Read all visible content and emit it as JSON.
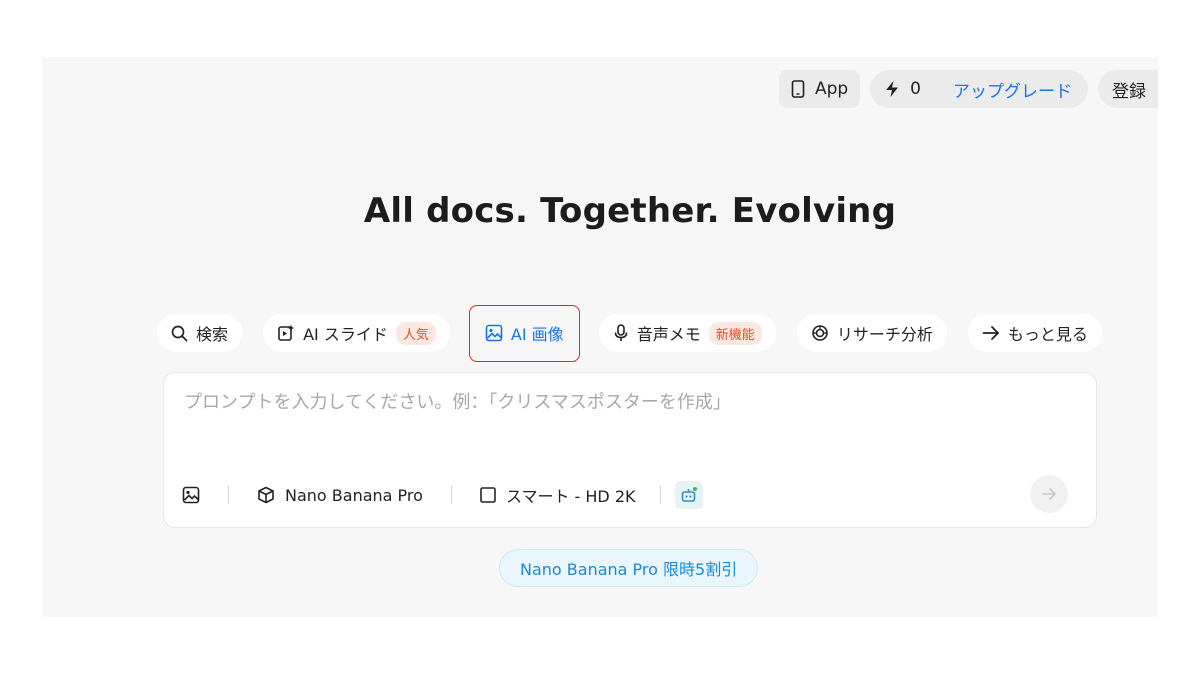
{
  "topbar": {
    "app_label": "App",
    "credits": "0",
    "upgrade_label": "アップグレード",
    "login_label": "登録"
  },
  "title": "All docs. Together. Evolving",
  "tabs": [
    {
      "label": "検索",
      "icon": "search-icon",
      "badge": ""
    },
    {
      "label": "AI スライド",
      "icon": "ai-slides-icon",
      "badge": "人気"
    },
    {
      "label": "AI 画像",
      "icon": "image-icon",
      "badge": "",
      "active": true
    },
    {
      "label": "音声メモ",
      "icon": "microphone-icon",
      "badge": "新機能"
    },
    {
      "label": "リサーチ分析",
      "icon": "research-icon",
      "badge": ""
    },
    {
      "label": "もっと見る",
      "icon": "arrow-right-icon",
      "badge": ""
    }
  ],
  "prompt": {
    "placeholder": "プロンプトを入力してください。例：「クリスマスポスターを作成」",
    "value": ""
  },
  "toolbar": {
    "model_label": "Nano Banana Pro",
    "quality_label": "スマート - HD 2K"
  },
  "promo": {
    "label": "Nano Banana Pro 限時5割引"
  },
  "colors": {
    "accent": "#1a73e8",
    "badge_text": "#d9512b",
    "badge_bg": "#fde8e1",
    "highlight_border": "#e0242a",
    "promo_text": "#1a8ad6",
    "promo_bg": "#e9f6fd"
  }
}
